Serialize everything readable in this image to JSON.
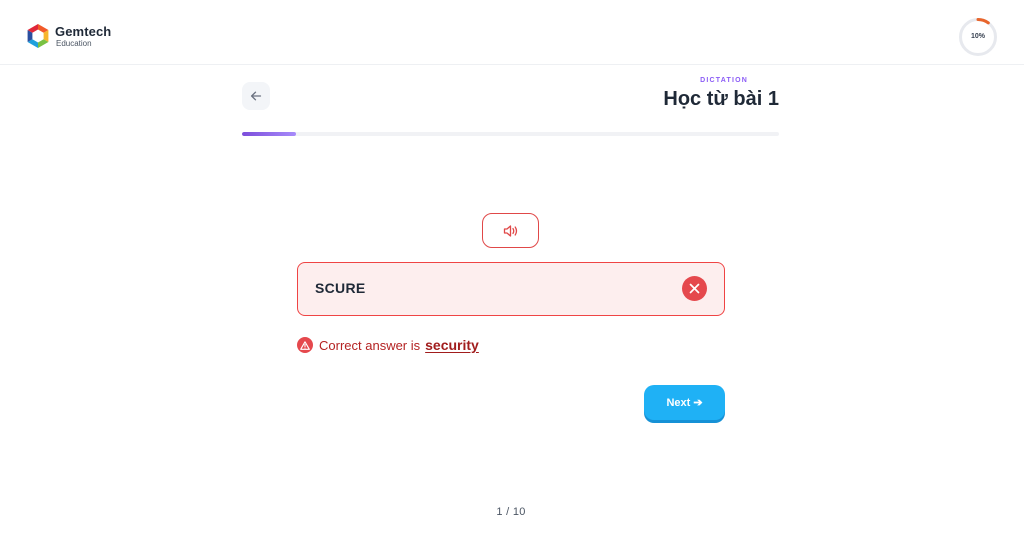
{
  "brand": {
    "name": "Gemtech",
    "subtitle": "Education",
    "logo_icon": "hexagon-cube-logo"
  },
  "session": {
    "completion_label": "10%",
    "completion_value": 0.1,
    "ring_color": "#e8652c"
  },
  "header": {
    "back_icon": "arrow-left-icon",
    "mode": "DICTATION",
    "title": "Học từ bài 1"
  },
  "progress": {
    "value": 0.1,
    "color": "#7c4ddb"
  },
  "exercise": {
    "audio_icon": "speaker-icon",
    "answer_value": "SCURE",
    "answer_state": "incorrect",
    "clear_icon": "close-icon"
  },
  "feedback": {
    "icon": "warning-icon",
    "label": "Correct answer is",
    "correct_word": "security",
    "color": "#e5484d"
  },
  "actions": {
    "next_label": "Next",
    "next_icon": "arrow-right-icon"
  },
  "pagination": {
    "text": "1 / 10"
  }
}
